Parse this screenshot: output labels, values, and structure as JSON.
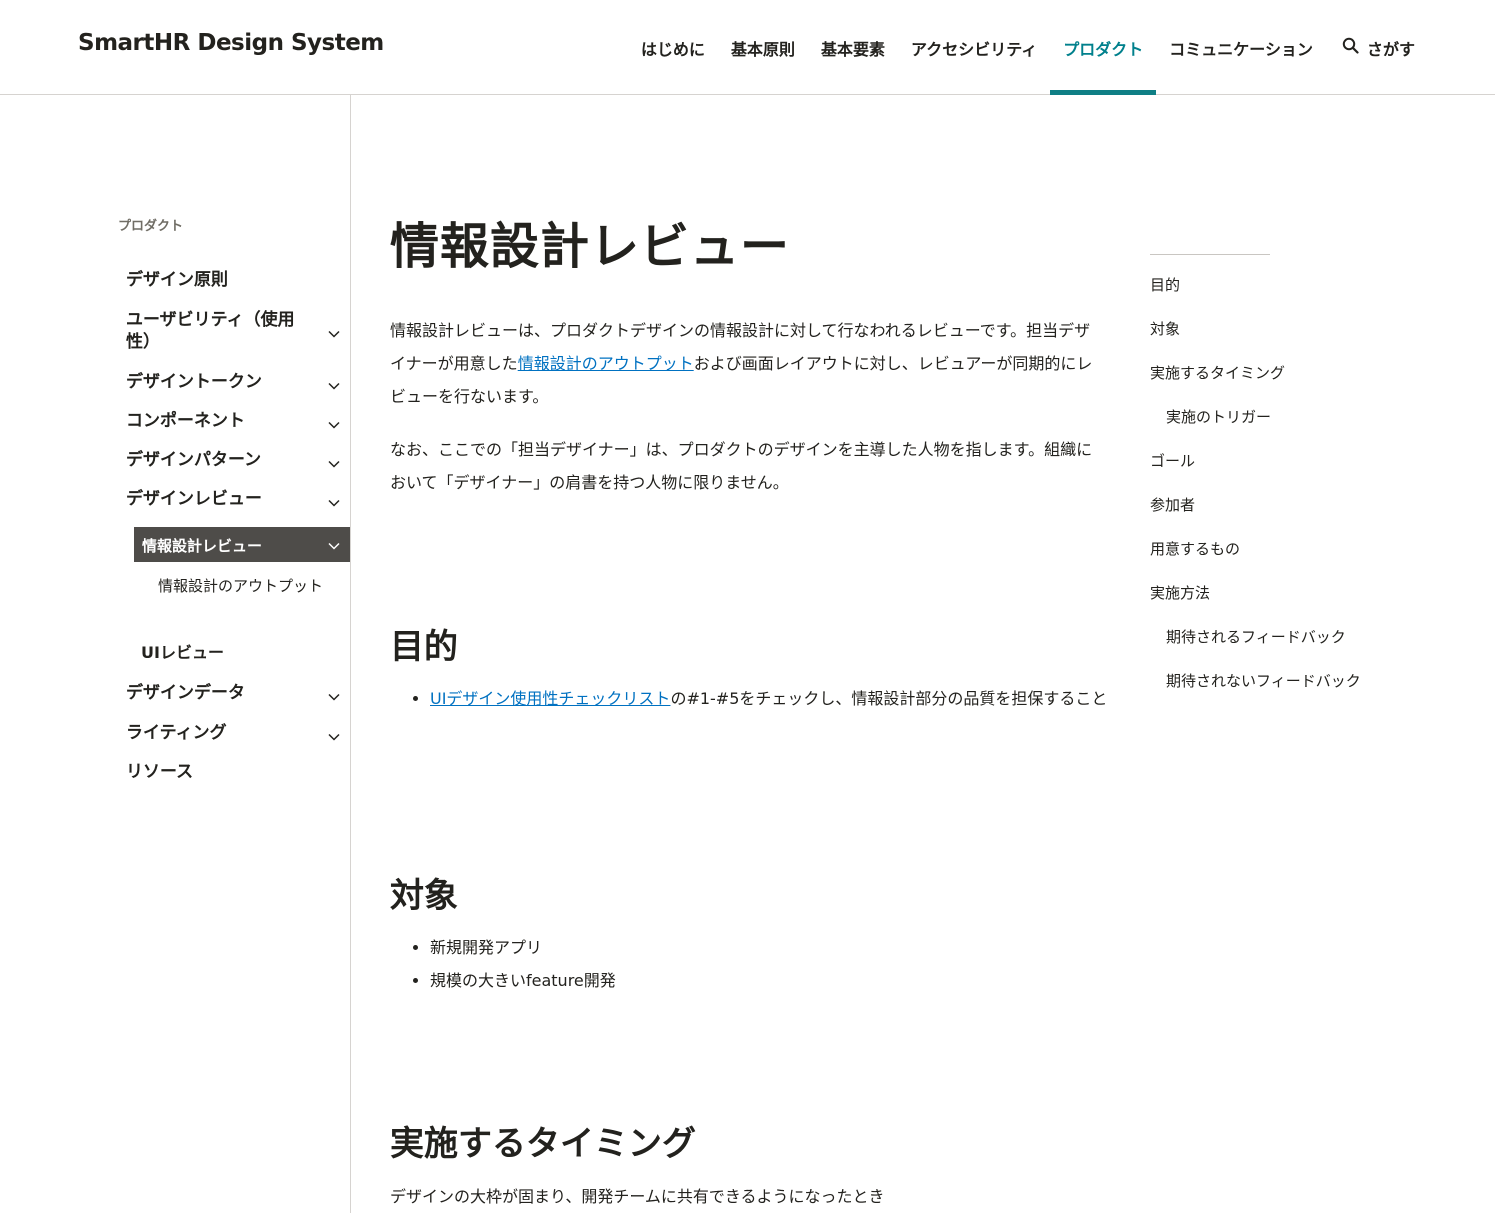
{
  "header": {
    "logo": "SmartHR Design System",
    "nav": [
      {
        "label": "はじめに",
        "active": false
      },
      {
        "label": "基本原則",
        "active": false
      },
      {
        "label": "基本要素",
        "active": false
      },
      {
        "label": "アクセシビリティ",
        "active": false
      },
      {
        "label": "プロダクト",
        "active": true
      },
      {
        "label": "コミュニケーション",
        "active": false
      }
    ],
    "search_label": "さがす",
    "accent": "#00808c"
  },
  "sidebar": {
    "category": "プロダクト",
    "items": [
      {
        "label": "デザイン原則",
        "expandable": false
      },
      {
        "label": "ユーザビリティ（使用性）",
        "expandable": true
      },
      {
        "label": "デザイントークン",
        "expandable": true
      },
      {
        "label": "コンポーネント",
        "expandable": true
      },
      {
        "label": "デザインパターン",
        "expandable": true
      },
      {
        "label": "デザインレビュー",
        "expandable": true
      },
      {
        "label": "デザインデータ",
        "expandable": true
      },
      {
        "label": "ライティング",
        "expandable": true
      },
      {
        "label": "リソース",
        "expandable": false
      }
    ],
    "active_item": "情報設計レビュー",
    "active_sub": "情報設計のアウトプット",
    "sibling": "UIレビュー"
  },
  "main": {
    "title": "情報設計レビュー",
    "intro_1_before": "情報設計レビューは、プロダクトデザインの情報設計に対して行なわれるレビューです。担当デザイナーが用意した",
    "intro_1_link": "情報設計のアウトプット",
    "intro_1_after": "および画面レイアウトに対し、レビュアーが同期的にレビューを行ないます。",
    "intro_2": "なお、ここでの「担当デザイナー」は、プロダクトのデザインを主導した人物を指します。組織において「デザイナー」の肩書を持つ人物に限りません。",
    "purpose_heading": "目的",
    "purpose_link": "UIデザイン使用性チェックリスト",
    "purpose_text": "の#1-#5をチェックし、情報設計部分の品質を担保すること",
    "target_heading": "対象",
    "target_items": [
      "新規開発アプリ",
      "規模の大きいfeature開発"
    ],
    "timing_heading": "実施するタイミング",
    "timing_text": "デザインの大枠が固まり、開発チームに共有できるようになったとき"
  },
  "toc": {
    "items": [
      {
        "label": "目的",
        "level": 1
      },
      {
        "label": "対象",
        "level": 1
      },
      {
        "label": "実施するタイミング",
        "level": 1
      },
      {
        "label": "実施のトリガー",
        "level": 2
      },
      {
        "label": "ゴール",
        "level": 1
      },
      {
        "label": "参加者",
        "level": 1
      },
      {
        "label": "用意するもの",
        "level": 1
      },
      {
        "label": "実施方法",
        "level": 1
      },
      {
        "label": "期待されるフィードバック",
        "level": 2
      },
      {
        "label": "期待されないフィードバック",
        "level": 2
      }
    ]
  }
}
